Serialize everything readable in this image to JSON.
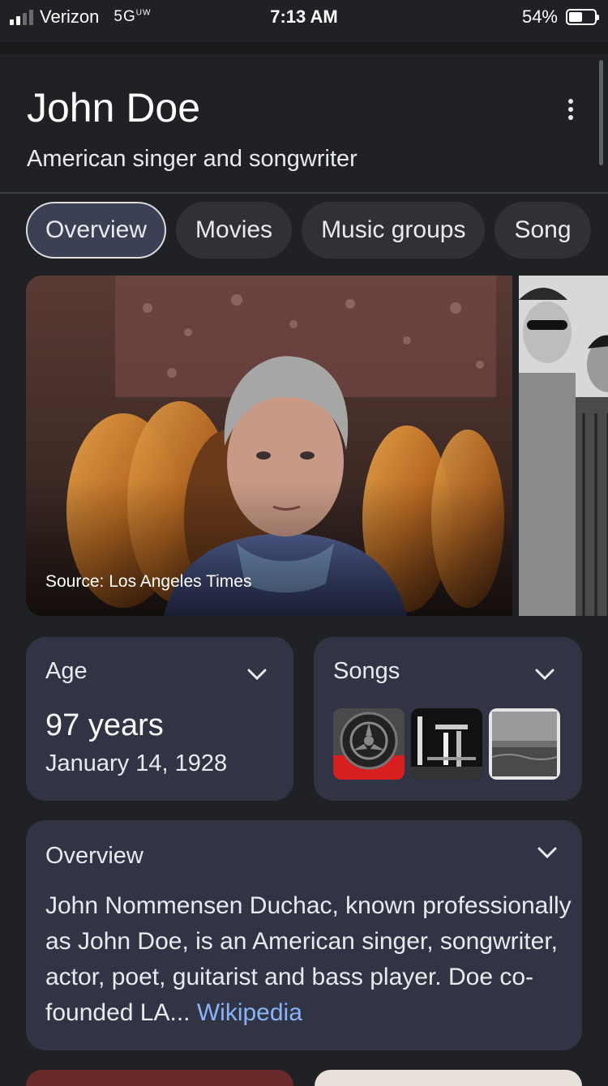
{
  "status_bar": {
    "carrier": "Verizon",
    "network": "5G",
    "network_badge": "UW",
    "time": "7:13 AM",
    "battery_percent": "54%",
    "battery_level": 0.54
  },
  "entity": {
    "name": "John Doe",
    "description": "American singer and songwriter",
    "more_icon": "more-vertical-icon"
  },
  "tabs": [
    {
      "label": "Overview",
      "active": true
    },
    {
      "label": "Movies",
      "active": false
    },
    {
      "label": "Music groups",
      "active": false
    },
    {
      "label": "Song",
      "active": false
    }
  ],
  "media": {
    "credit": "Source: Los Angeles Times"
  },
  "age_card": {
    "title": "Age",
    "value": "97 years",
    "date": "January 14, 1928"
  },
  "songs_card": {
    "title": "Songs"
  },
  "overview_card": {
    "title": "Overview",
    "text": "John Nommensen Duchac, known professionally as John Doe, is an American singer, songwriter, actor, poet, guitarist and bass player. Doe co-founded LA",
    "ellipsis": "...",
    "link_text": "Wikipedia"
  },
  "colors": {
    "background": "#202124",
    "card": "#303445",
    "chip": "#303134",
    "link": "#8ab4f8"
  }
}
